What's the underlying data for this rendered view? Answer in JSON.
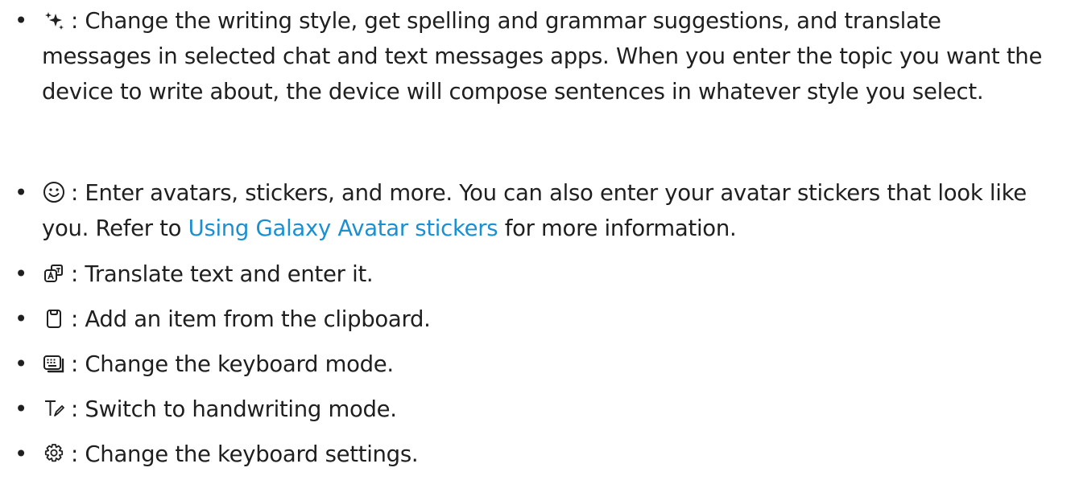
{
  "items": [
    {
      "icon": "sparkle-ai-icon",
      "text": ": Change the writing style, get spelling and grammar suggestions, and translate messages in selected chat and text messages apps. When you enter the topic you want the device to write about, the device will compose sentences in whatever style you select."
    },
    {
      "icon": "emoji-smile-icon",
      "text_before": ": Enter avatars, stickers, and more. You can also enter your avatar stickers that look like you. Refer to ",
      "link": "Using Galaxy Avatar stickers",
      "text_after": " for more information."
    },
    {
      "icon": "translate-icon",
      "text": ": Translate text and enter it."
    },
    {
      "icon": "clipboard-icon",
      "text": ": Add an item from the clipboard."
    },
    {
      "icon": "keyboard-mode-icon",
      "text": ": Change the keyboard mode."
    },
    {
      "icon": "handwriting-icon",
      "text": ": Switch to handwriting mode."
    },
    {
      "icon": "gear-icon",
      "text": ": Change the keyboard settings."
    }
  ],
  "colors": {
    "text": "#1f1f1f",
    "link": "#1a8fd1"
  }
}
